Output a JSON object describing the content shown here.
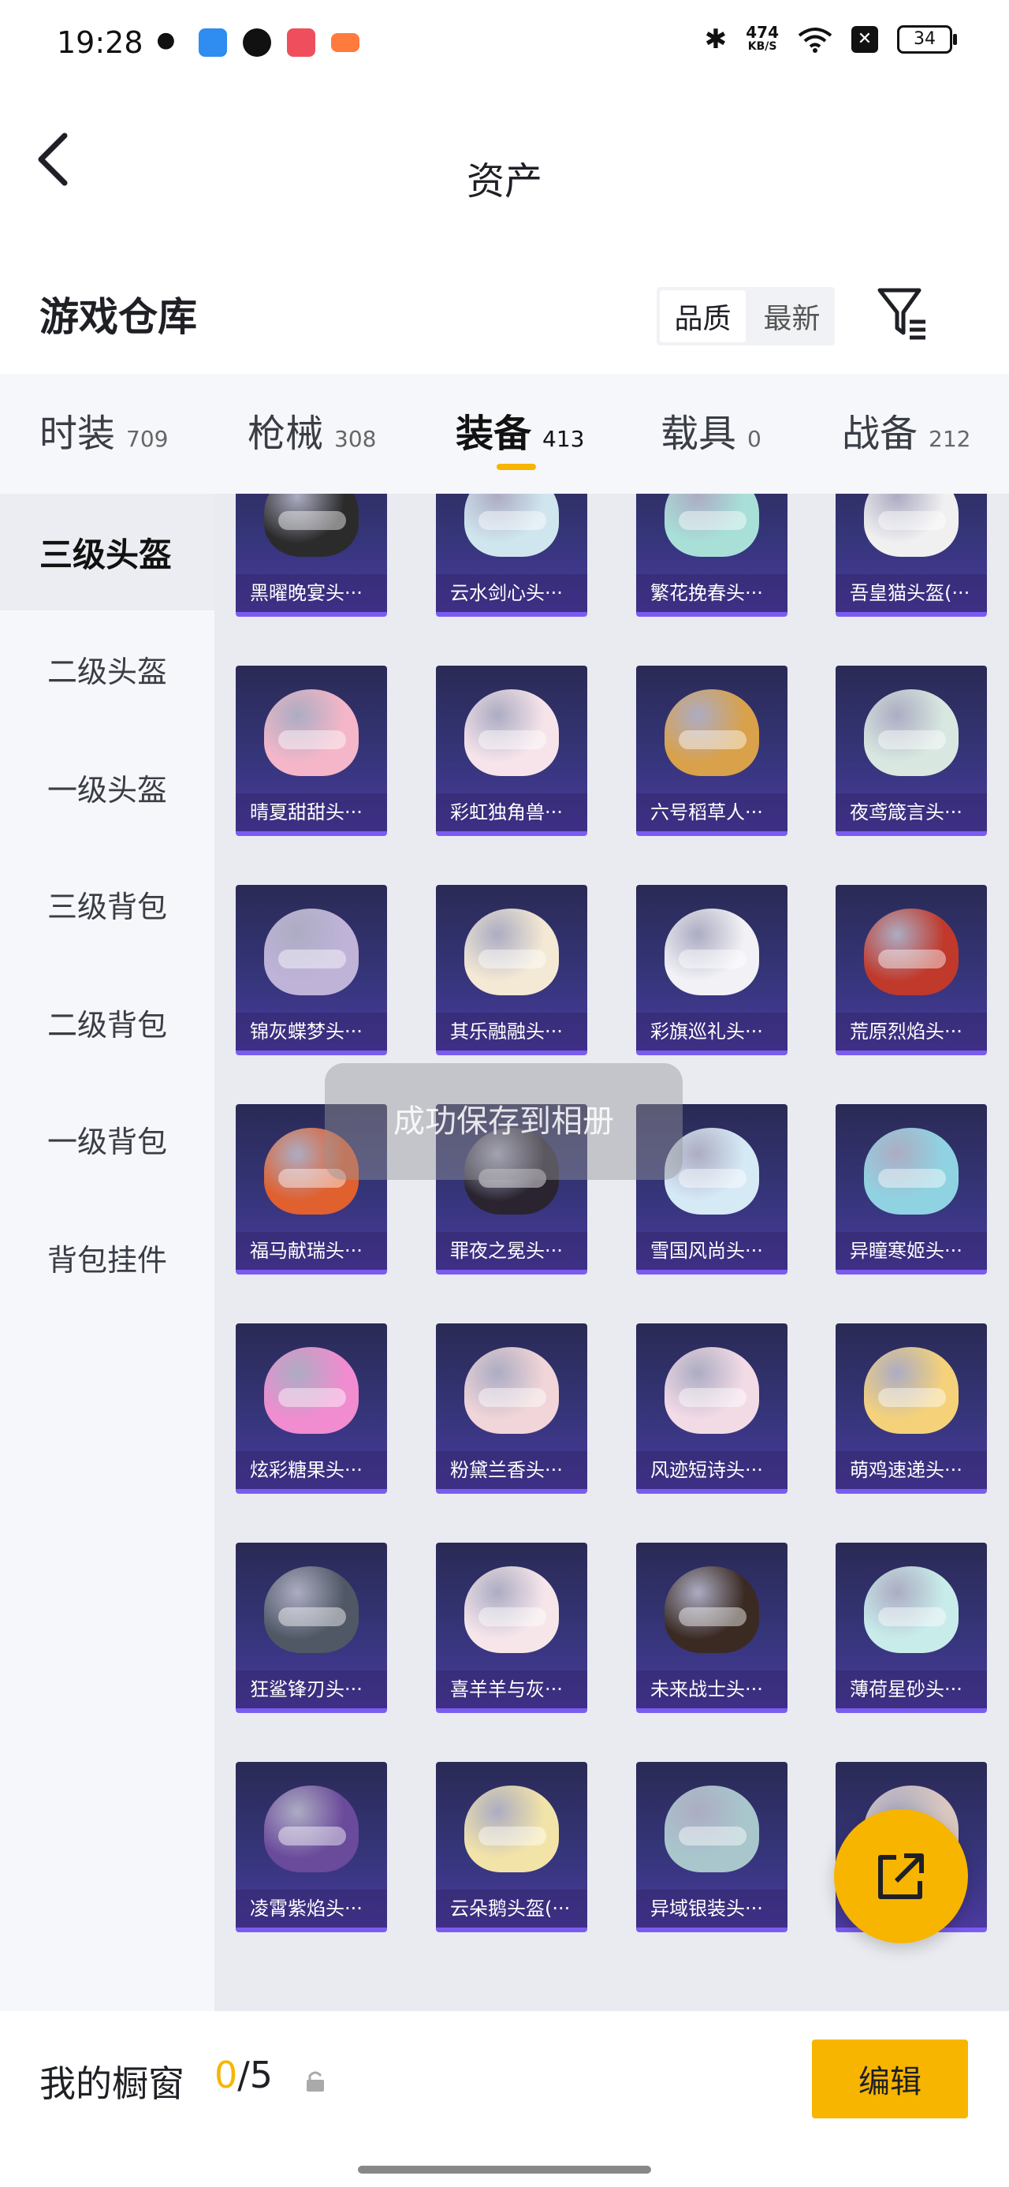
{
  "status_bar": {
    "time": "19:28",
    "net_speed_value": "474",
    "net_speed_unit": "KB/S",
    "battery": "34",
    "icons": [
      "wechat-icon",
      "blue-app-icon",
      "shield-app-icon",
      "video-app-icon",
      "game-app-icon",
      "bluetooth-icon",
      "wifi-icon",
      "close-box-icon"
    ]
  },
  "nav": {
    "title": "资产",
    "back_icon": "chevron-left-icon"
  },
  "section": {
    "title": "游戏仓库",
    "sort_options": [
      "品质",
      "最新"
    ],
    "active_sort": "品质",
    "filter_icon": "filter-list-icon"
  },
  "tabs": [
    {
      "name": "时装",
      "count": "709"
    },
    {
      "name": "枪械",
      "count": "308"
    },
    {
      "name": "装备",
      "count": "413",
      "active": true
    },
    {
      "name": "载具",
      "count": "0"
    },
    {
      "name": "战备",
      "count": "212"
    }
  ],
  "sidebar": [
    {
      "label": "三级头盔",
      "active": true
    },
    {
      "label": "二级头盔"
    },
    {
      "label": "一级头盔"
    },
    {
      "label": "三级背包"
    },
    {
      "label": "二级背包"
    },
    {
      "label": "一级背包"
    },
    {
      "label": "背包挂件"
    }
  ],
  "items": [
    {
      "label": "黑曜晚宴头···",
      "color": "#2b2b2b"
    },
    {
      "label": "云水剑心头···",
      "color": "#cfe6ee"
    },
    {
      "label": "繁花挽春头···",
      "color": "#a8e0d8"
    },
    {
      "label": "吾皇猫头盔(···",
      "color": "#f0f0f0"
    },
    {
      "label": "晴夏甜甜头···",
      "color": "#f4b6c8"
    },
    {
      "label": "彩虹独角兽···",
      "color": "#f7e4ea"
    },
    {
      "label": "六号稻草人···",
      "color": "#d9a14a"
    },
    {
      "label": "夜鸢箴言头···",
      "color": "#d8e8e0"
    },
    {
      "label": "锦灰蝶梦头···",
      "color": "#bfb3d8"
    },
    {
      "label": "其乐融融头···",
      "color": "#f4e9d4"
    },
    {
      "label": "彩旗巡礼头···",
      "color": "#f2f2f6"
    },
    {
      "label": "荒原烈焰头···",
      "color": "#c0392b"
    },
    {
      "label": "福马献瑞头···",
      "color": "#e0602e"
    },
    {
      "label": "罪夜之冕头···",
      "color": "#2a2430"
    },
    {
      "label": "雪国风尚头···",
      "color": "#d6eaf6"
    },
    {
      "label": "异瞳寒姬头···",
      "color": "#8fd3e2"
    },
    {
      "label": "炫彩糖果头···",
      "color": "#f08ccf"
    },
    {
      "label": "粉黛兰香头···",
      "color": "#f1d5d8"
    },
    {
      "label": "风迹短诗头···",
      "color": "#f3dbe6"
    },
    {
      "label": "萌鸡速递头···",
      "color": "#f5d27a"
    },
    {
      "label": "狂鲨锋刃头···",
      "color": "#505866"
    },
    {
      "label": "喜羊羊与灰···",
      "color": "#f6e6ea"
    },
    {
      "label": "未来战士头···",
      "color": "#3a2a22"
    },
    {
      "label": "薄荷星砂头···",
      "color": "#c8ecea"
    },
    {
      "label": "凌霄紫焰头···",
      "color": "#6a4a9a"
    },
    {
      "label": "云朵鹅头盔(···",
      "color": "#f2e4a8"
    },
    {
      "label": "异域银装头···",
      "color": "#a8c6cc"
    },
    {
      "label": "",
      "color": "#d9c7c0"
    }
  ],
  "toast": "成功保存到相册",
  "fab_icon": "share-out-icon",
  "bottom": {
    "label": "我的橱窗",
    "used": "0",
    "separator": "/",
    "total": "5",
    "lock_icon": "lock-icon",
    "edit_label": "编辑"
  }
}
